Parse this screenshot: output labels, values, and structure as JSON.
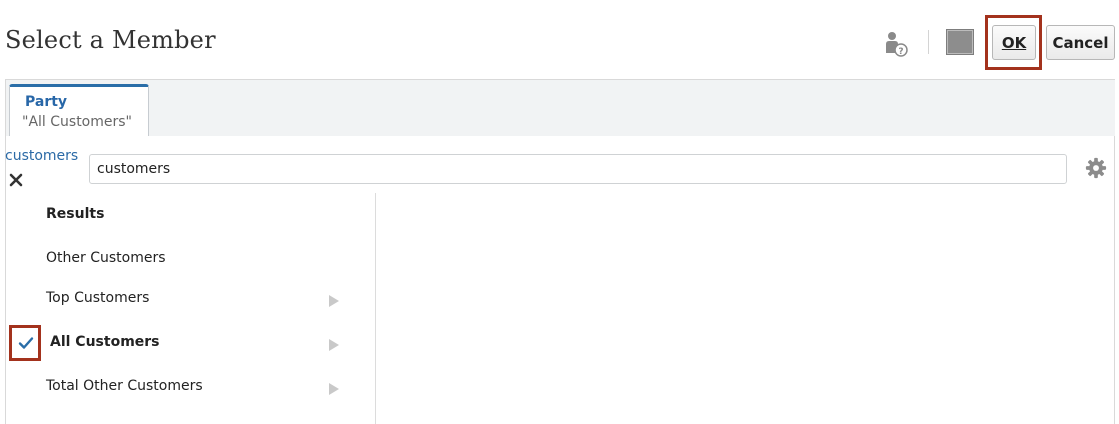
{
  "dialog": {
    "title": "Select a Member"
  },
  "header": {
    "icons": {
      "help": "person-help-icon",
      "color": "color-swatch-icon"
    },
    "colors": {
      "swatch": "#8d8d8d",
      "highlight": "#a3321d"
    },
    "ok_label": "OK",
    "cancel_label": "Cancel"
  },
  "tabs": [
    {
      "name": "Party",
      "value": "\"All Customers\""
    }
  ],
  "search": {
    "crumb_label": "customers",
    "value": "customers",
    "clear_icon": "close-icon",
    "options_icon": "gear-icon"
  },
  "results": {
    "heading": "Results",
    "items": [
      {
        "label": "Other Customers",
        "has_children": false,
        "selected": false
      },
      {
        "label": "Top Customers",
        "has_children": true,
        "selected": false
      },
      {
        "label": "All Customers",
        "has_children": true,
        "selected": true
      },
      {
        "label": "Total Other Customers",
        "has_children": true,
        "selected": false
      }
    ]
  },
  "accent_color": "#2a6ea8"
}
